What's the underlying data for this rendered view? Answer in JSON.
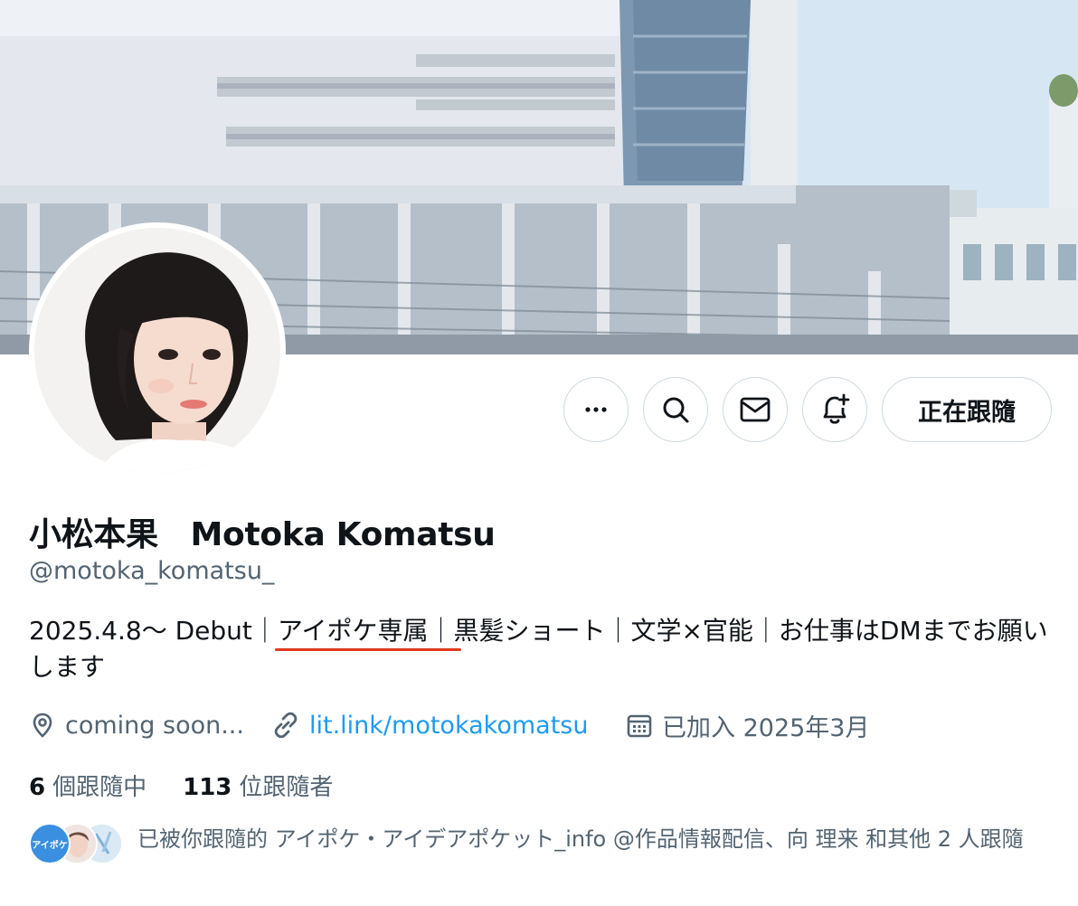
{
  "profile": {
    "display_name": "小松本果　Motoka Komatsu",
    "handle": "@motoka_komatsu_",
    "bio": "2025.4.8～ Debut｜アイポケ専属｜黒髪ショート｜文学×官能｜お仕事はDMまでお願いします",
    "location": "coming soon...",
    "website": "lit.link/motokakomatsu",
    "joined": "已加入 2025年3月"
  },
  "actions": {
    "more_icon": "more-horizontal-icon",
    "search_icon": "search-icon",
    "message_icon": "envelope-icon",
    "notify_icon": "bell-plus-icon",
    "follow_label": "正在跟隨"
  },
  "stats": {
    "following_count": "6",
    "following_label": "個跟隨中",
    "followers_count": "113",
    "followers_label": "位跟隨者"
  },
  "followed_by": {
    "text": "已被你跟隨的 アイポケ・アイデアポケット_info @作品情報配信、向 理来 和其他 2 人跟隨",
    "avatar1_text": "アイポケ"
  },
  "colors": {
    "text_primary": "#0f1419",
    "text_secondary": "#536471",
    "link": "#1d9bf0",
    "border": "#cfd9de",
    "underline_annotation": "#e0391f"
  }
}
